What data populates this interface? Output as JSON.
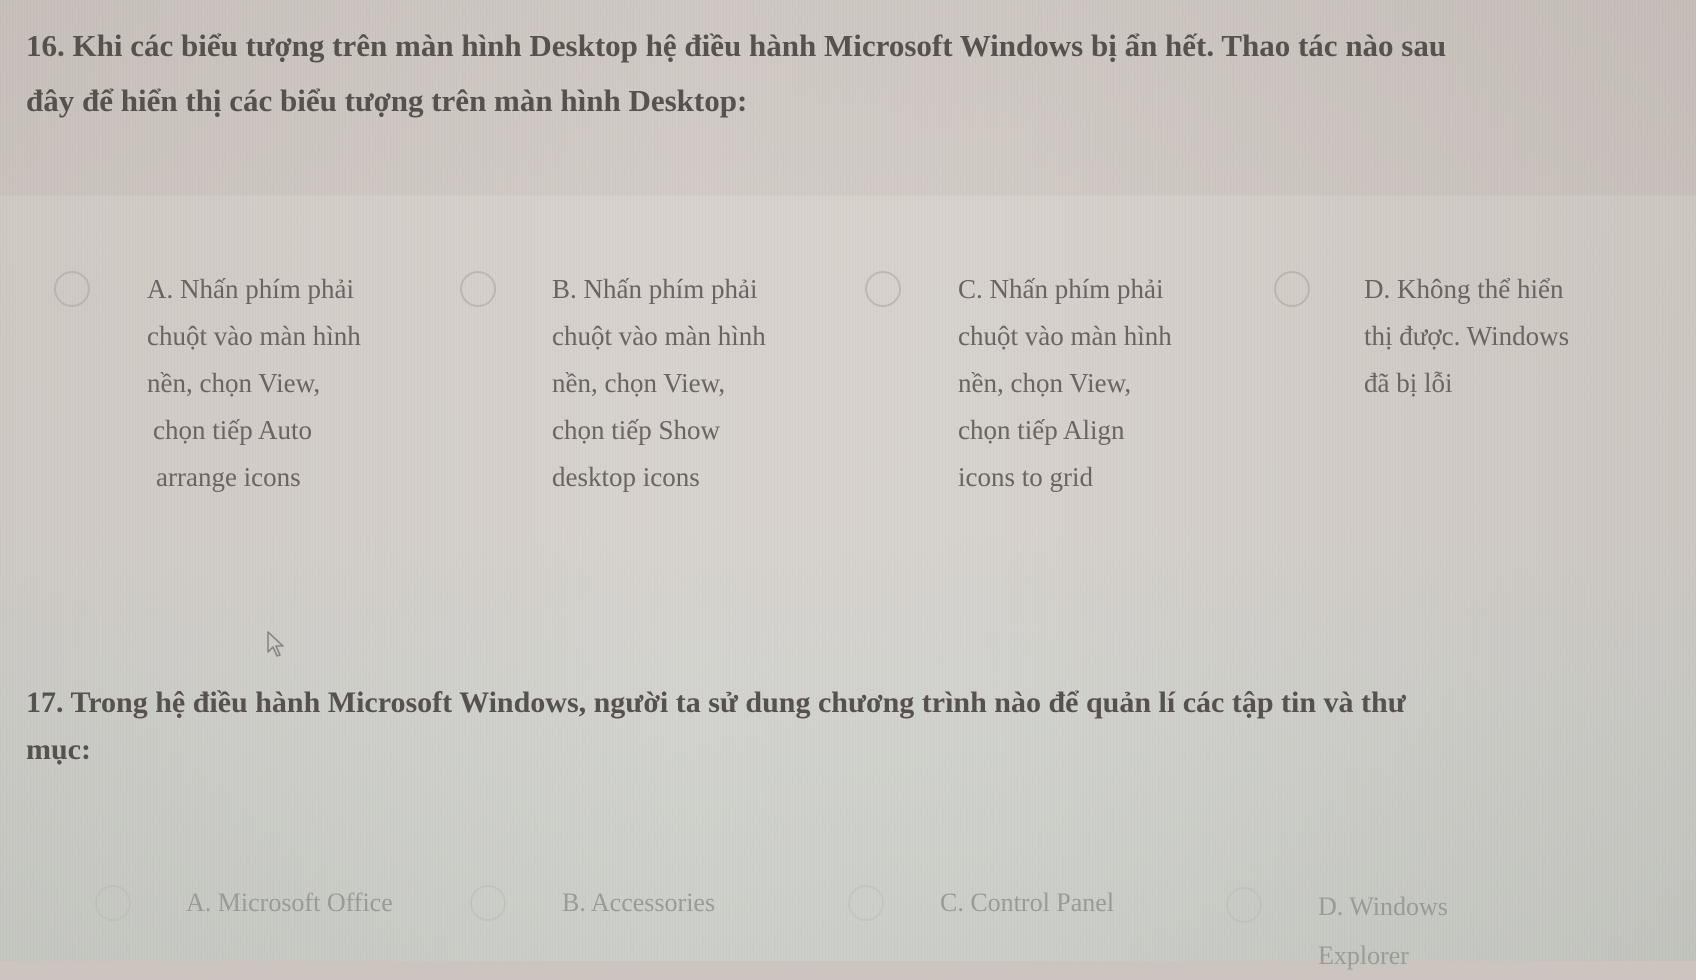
{
  "questions": [
    {
      "number": "16.",
      "title_line1": "16. Khi các biểu tượng trên màn hình Desktop hệ điều hành Microsoft Windows bị ẩn hết. Thao tác nào sau",
      "title_line2": "đây để hiển thị các biểu tượng trên màn hình Desktop:",
      "options": [
        {
          "key": "A",
          "lines": [
            "A. Nhấn phím phải",
            "chuột vào màn hình",
            "nền, chọn View,",
            "chọn tiếp Auto",
            "arrange icons"
          ]
        },
        {
          "key": "B",
          "lines": [
            "B. Nhấn phím phải",
            "chuột vào màn hình",
            "nền, chọn View,",
            "chọn tiếp Show",
            "desktop icons"
          ]
        },
        {
          "key": "C",
          "lines": [
            "C. Nhấn phím phải",
            "chuột vào màn hình",
            "nền, chọn View,",
            "chọn tiếp Align",
            "icons to grid"
          ]
        },
        {
          "key": "D",
          "lines": [
            "D. Không thể hiển",
            "thị được. Windows",
            "đã bị lỗi"
          ]
        }
      ]
    },
    {
      "number": "17.",
      "title_line1": "17. Trong hệ điều hành Microsoft Windows, người ta sử dung chương trình nào để quản lí các tập tin và thư",
      "title_line2": "mục:",
      "options": [
        {
          "key": "A",
          "lines": [
            "A. Microsoft Office"
          ]
        },
        {
          "key": "B",
          "lines": [
            "B. Accessories"
          ]
        },
        {
          "key": "C",
          "lines": [
            "C. Control Panel"
          ]
        },
        {
          "key": "D",
          "lines": [
            "D. Windows",
            "Explorer"
          ]
        }
      ]
    }
  ],
  "icons": {
    "pointer": "mouse-pointer-icon",
    "radio": "radio-unchecked-icon"
  }
}
